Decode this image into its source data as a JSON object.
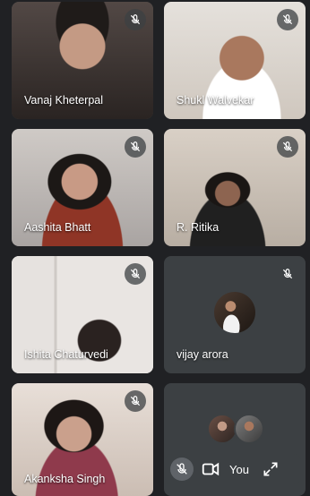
{
  "participants": [
    {
      "name": "Vanaj Kheterpal",
      "muted": true,
      "bg": "#3a3532"
    },
    {
      "name": "Shukl Walvekar",
      "muted": true,
      "bg": "#d8d2cb"
    },
    {
      "name": "Aashita Bhatt",
      "muted": true,
      "bg": "#b9b4b1"
    },
    {
      "name": "R. Ritika",
      "muted": true,
      "bg": "#c8bfb5"
    },
    {
      "name": "Ishita Chaturvedi",
      "muted": true,
      "bg": "#cfc9c6"
    },
    {
      "name": "vijay arora",
      "muted": true,
      "bg": "#3c4043"
    },
    {
      "name": "Akanksha Singh",
      "muted": true,
      "bg": "#d9cfc8"
    }
  ],
  "self_tile": {
    "label": "You",
    "icons": [
      "mic-off-icon",
      "camera-icon",
      "expand-icon"
    ]
  },
  "colors": {
    "page_bg": "#202124",
    "tile_bg": "#3c4043",
    "text": "#ffffff"
  }
}
